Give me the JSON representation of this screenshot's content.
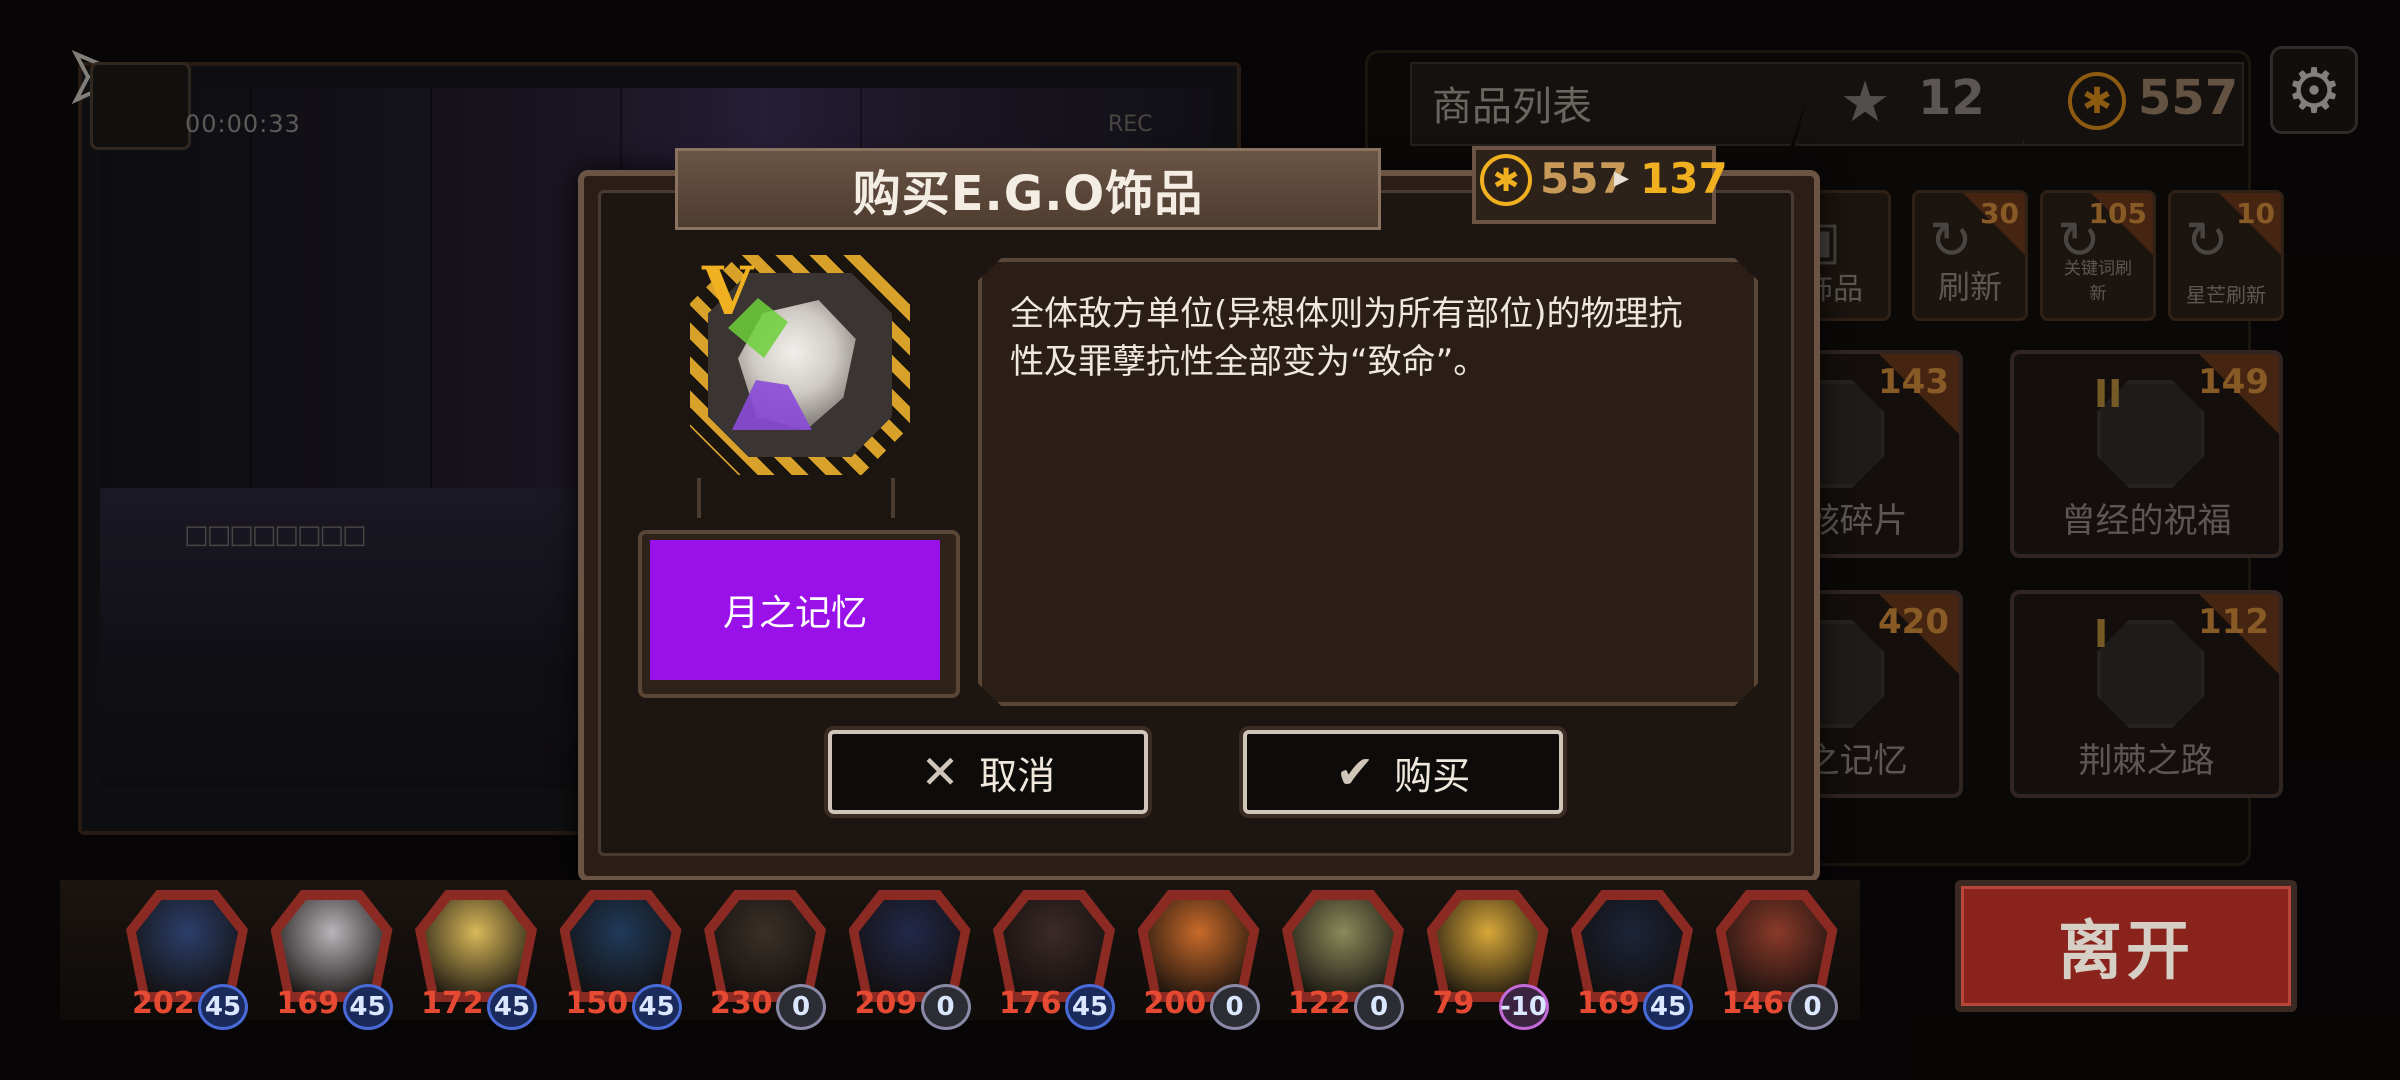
{
  "video": {
    "timer": "00:00:33",
    "rec_label": "REC",
    "glitch_text": "□□□□□□□□"
  },
  "shop": {
    "title": "商品列表",
    "stars": "12",
    "coins": "557",
    "tools": [
      {
        "label": "饰品",
        "cost": ""
      },
      {
        "label": "刷新",
        "cost": "30"
      },
      {
        "label": "关键词刷新",
        "cost": "105"
      },
      {
        "label": "星芒刷新",
        "cost": "10"
      }
    ],
    "items": [
      {
        "name": "骸碎片",
        "cost": "143",
        "tier": ""
      },
      {
        "name": "曾经的祝福",
        "cost": "149",
        "tier": "II"
      },
      {
        "name": "之记忆",
        "cost": "420",
        "tier": ""
      },
      {
        "name": "荆棘之路",
        "cost": "112",
        "tier": "I"
      }
    ]
  },
  "modal": {
    "title": "购买E.G.O饰品",
    "price_old": "557",
    "price_arrow": "▸",
    "price_new": "137",
    "tier": "V",
    "item_name": "月之记忆",
    "description": "全体敌方单位(异想体则为所有部位)的物理抗性及罪孽抗性全部变为“致命”。",
    "cancel_label": "取消",
    "buy_label": "购买"
  },
  "party": [
    {
      "hp": "202",
      "sp": "45",
      "color": "#2b3f6a"
    },
    {
      "hp": "169",
      "sp": "45",
      "color": "#b8b4b8"
    },
    {
      "hp": "172",
      "sp": "45",
      "color": "#d8b85a"
    },
    {
      "hp": "150",
      "sp": "45",
      "color": "#1f3a5a"
    },
    {
      "hp": "230",
      "sp": "0",
      "color": "#3a3028"
    },
    {
      "hp": "209",
      "sp": "0",
      "color": "#22284a"
    },
    {
      "hp": "176",
      "sp": "45",
      "color": "#3b2a28"
    },
    {
      "hp": "200",
      "sp": "0",
      "color": "#c86a2a"
    },
    {
      "hp": "122",
      "sp": "0",
      "color": "#8a8a5a"
    },
    {
      "hp": "79",
      "sp": "-10",
      "color": "#d8a83a"
    },
    {
      "hp": "169",
      "sp": "45",
      "color": "#1c2438"
    },
    {
      "hp": "146",
      "sp": "0",
      "color": "#8a3a2a"
    }
  ],
  "leave_label": "离开"
}
